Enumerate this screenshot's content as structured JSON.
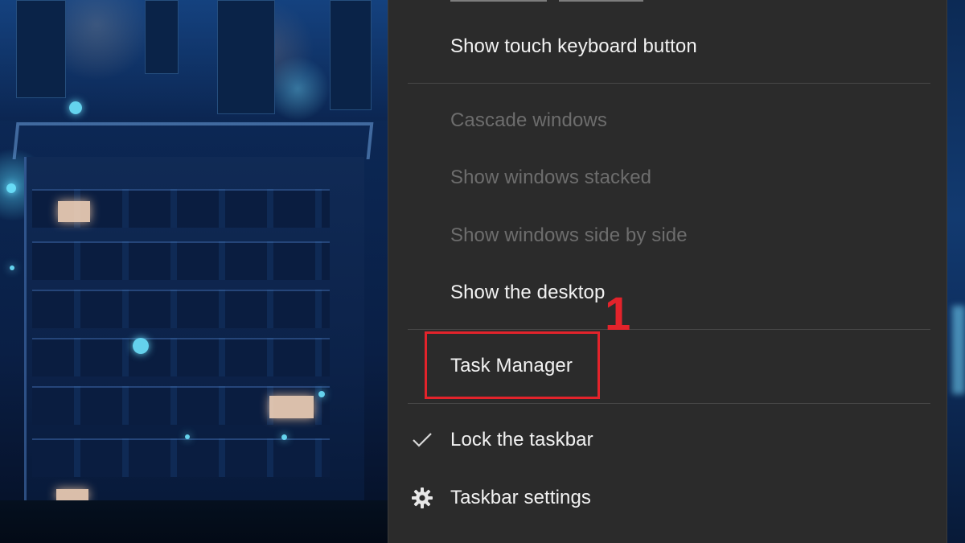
{
  "context_menu": {
    "items": [
      {
        "label": "Show touch keyboard button",
        "enabled": true
      },
      {
        "label": "Cascade windows",
        "enabled": false
      },
      {
        "label": "Show windows stacked",
        "enabled": false
      },
      {
        "label": "Show windows side by side",
        "enabled": false
      },
      {
        "label": "Show the desktop",
        "enabled": true
      },
      {
        "label": "Task Manager",
        "enabled": true
      },
      {
        "label": "Lock the taskbar",
        "enabled": true,
        "checked": true,
        "icon": "checkmark-icon"
      },
      {
        "label": "Taskbar settings",
        "enabled": true,
        "icon": "gear-icon"
      }
    ]
  },
  "annotation": {
    "step_number": "1",
    "highlighted_item": "Task Manager",
    "color": "#e3232b"
  },
  "colors": {
    "menu_background": "#2b2b2b",
    "menu_text": "#f2f2f2",
    "menu_text_disabled": "#6d6d6d",
    "separator": "#474747"
  }
}
